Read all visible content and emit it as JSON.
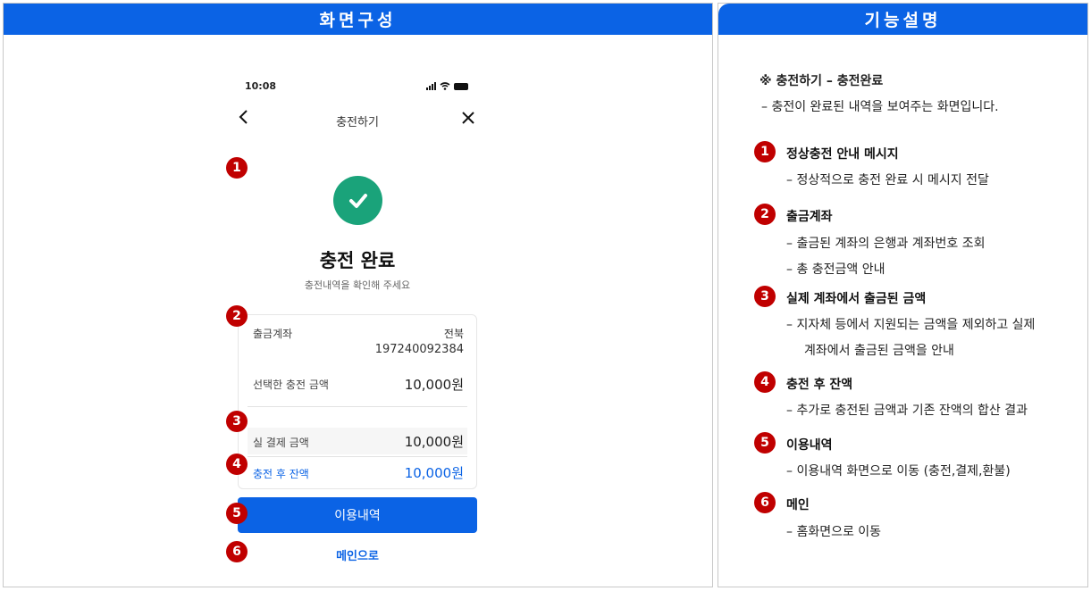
{
  "left_header": "화면구성",
  "right_header": "기능설명",
  "phone": {
    "status_time": "10:08",
    "nav_title": "충전하기",
    "done_title": "충전 완료",
    "done_sub": "충전내역을 확인해 주세요",
    "account_label": "출금계좌",
    "bank_name": "전북",
    "account_number": "197240092384",
    "selected_amount_label": "선택한 충전 금액",
    "selected_amount": "10,000원",
    "pay_label": "실 결제 금액",
    "pay_amount": "10,000원",
    "balance_label": "충전 후 잔액",
    "balance_amount": "10,000원",
    "history_button": "이용내역",
    "main_link": "메인으로"
  },
  "badges": [
    "1",
    "2",
    "3",
    "4",
    "5",
    "6"
  ],
  "description": {
    "heading": "※ 충전하기 – 충전완료",
    "summary": "–  충전이 완료된 내역을 보여주는 화면입니다.",
    "items": [
      {
        "num": "1",
        "title": "정상충전 안내 메시지",
        "subs": [
          "– 정상적으로 충전 완료 시 메시지 전달"
        ]
      },
      {
        "num": "2",
        "title": "출금계좌",
        "subs": [
          "–  출금된 계좌의 은행과 계좌번호 조회",
          "–  총 충전금액 안내"
        ]
      },
      {
        "num": "3",
        "title": "실제 계좌에서 출금된 금액",
        "subs": [
          "–  지자체 등에서 지원되는 금액을 제외하고 실제",
          "계좌에서 출금된 금액을 안내"
        ]
      },
      {
        "num": "4",
        "title": "충전 후 잔액",
        "subs": [
          "– 추가로 충전된 금액과 기존 잔액의 합산 결과"
        ]
      },
      {
        "num": "5",
        "title": "이용내역",
        "subs": [
          "–  이용내역 화면으로 이동 (충전,결제,환불)"
        ]
      },
      {
        "num": "6",
        "title": "메인",
        "subs": [
          "–  홈화면으로 이동"
        ]
      }
    ]
  },
  "colors": {
    "accent": "#0b63e5",
    "badge": "#c00000",
    "success": "#1aa37a"
  }
}
